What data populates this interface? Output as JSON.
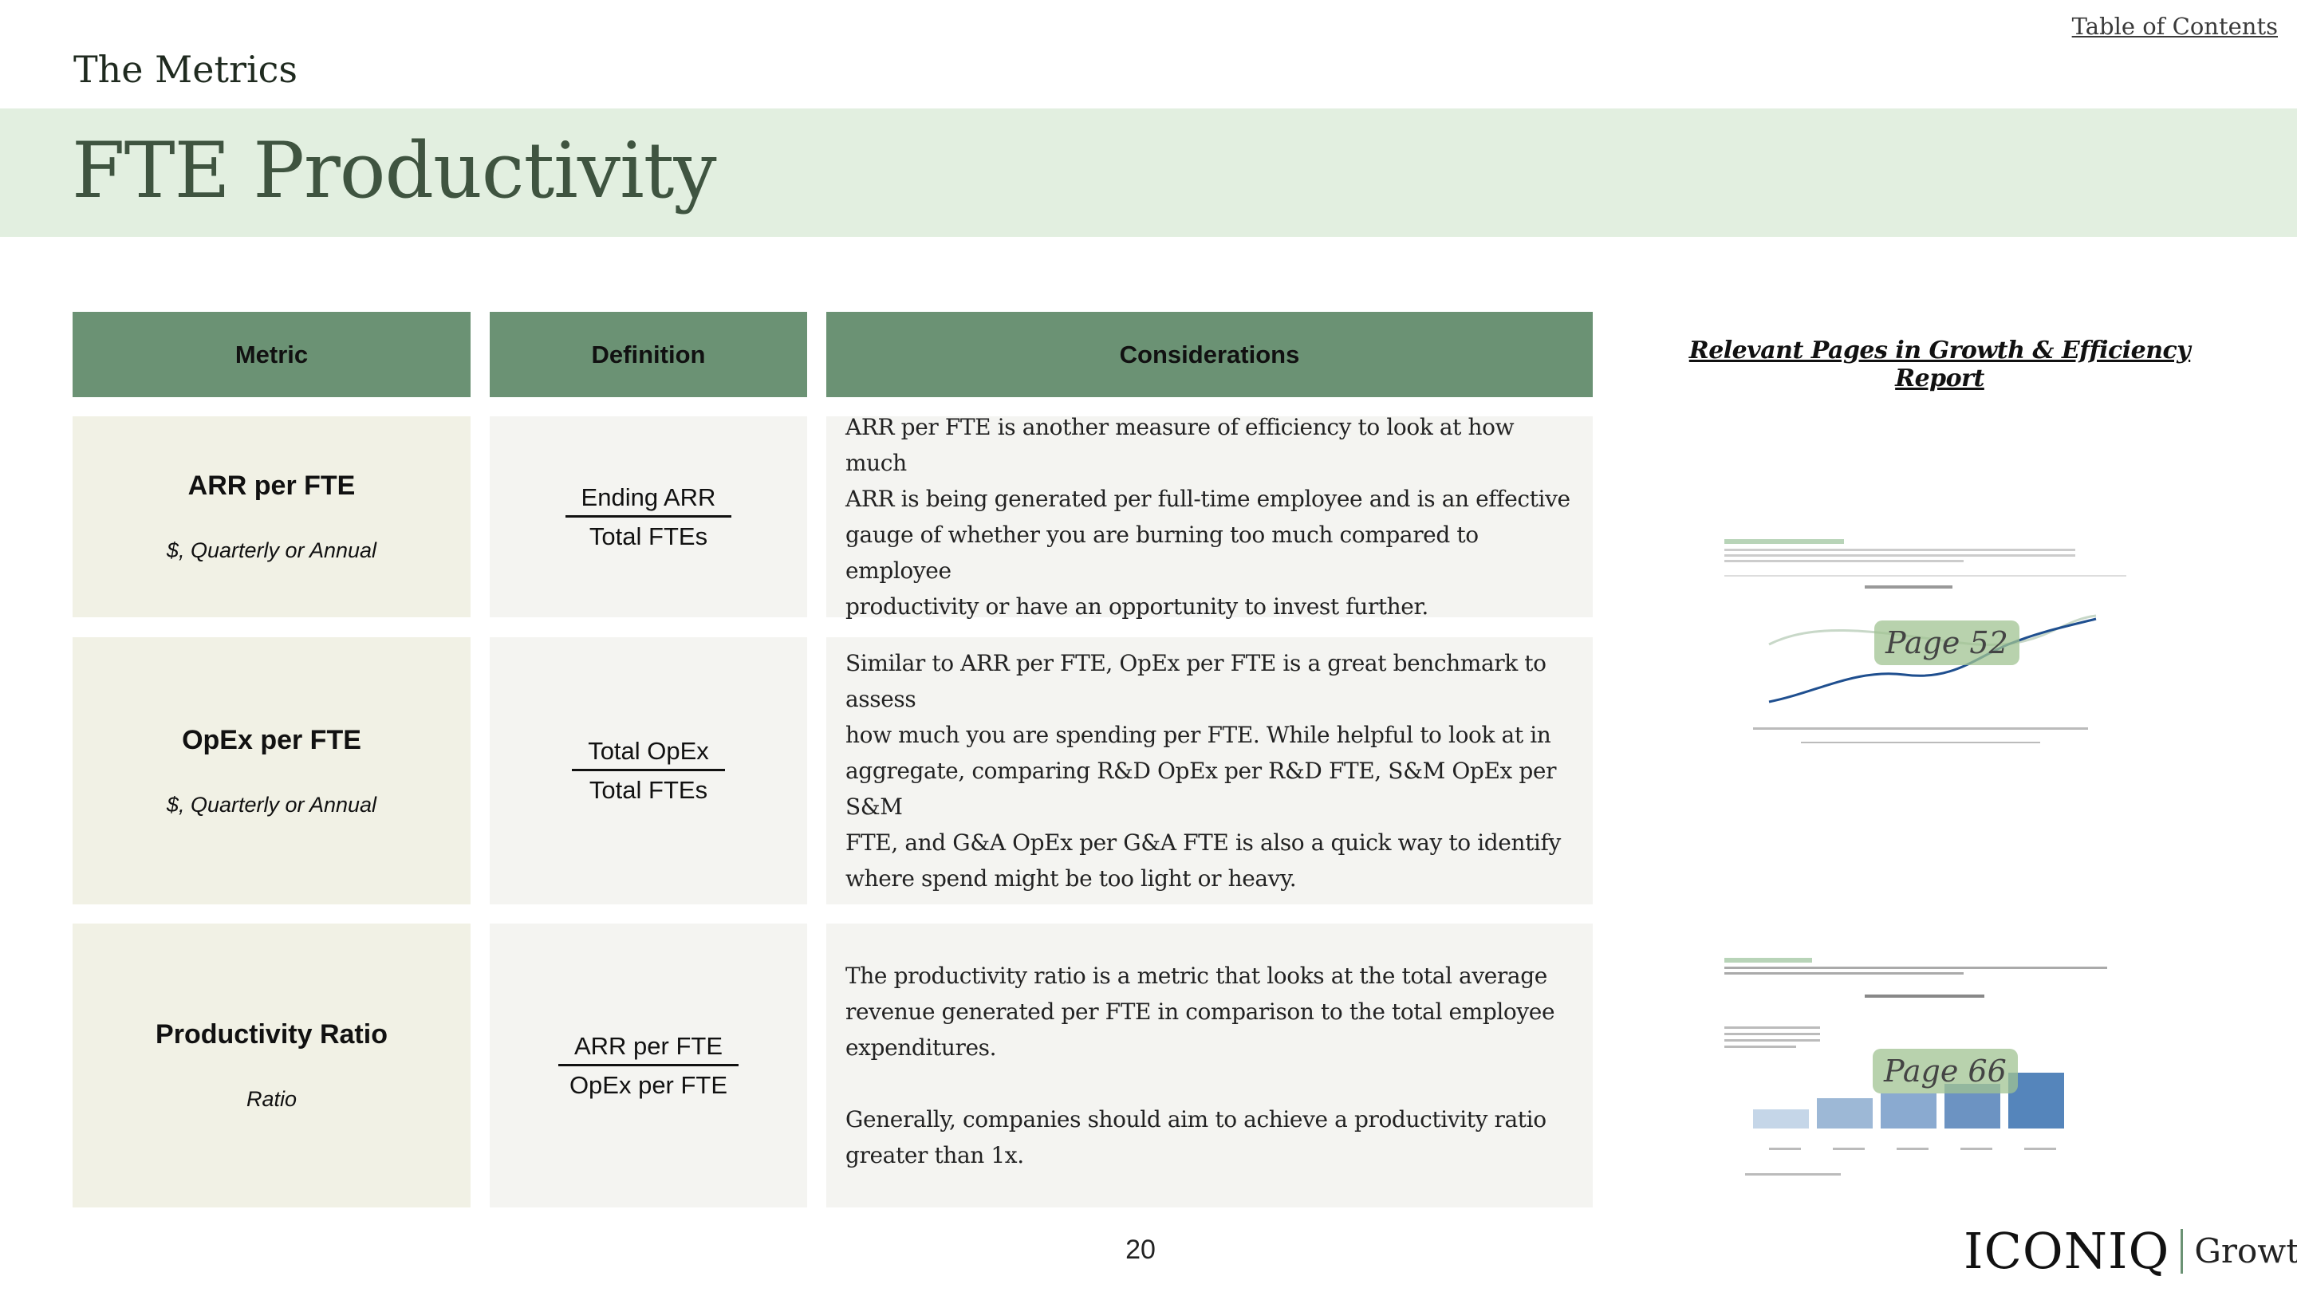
{
  "nav": {
    "toc_link": "Table of Contents"
  },
  "header": {
    "section": "The Metrics",
    "title": "FTE Productivity"
  },
  "table": {
    "headers": [
      "Metric",
      "Definition",
      "Considerations"
    ],
    "rows": [
      {
        "metric": "ARR per FTE",
        "subtitle": "$, Quarterly or Annual",
        "numerator": "Ending ARR",
        "denominator": "Total FTEs",
        "considerations": "ARR per FTE is another measure of efficiency to look at how much\nARR is being generated per full-time employee and is an effective\ngauge of whether you are burning too much compared to employee\nproductivity or have an opportunity to invest further."
      },
      {
        "metric": "OpEx per FTE",
        "subtitle": "$, Quarterly or Annual",
        "numerator": "Total OpEx",
        "denominator": "Total FTEs",
        "considerations": "Similar to ARR per FTE, OpEx per FTE is a great benchmark to assess\nhow much you are spending per FTE. While helpful to look at in\naggregate, comparing R&D OpEx per R&D FTE, S&M OpEx per S&M\nFTE, and G&A OpEx per G&A FTE is also a quick way to identify\nwhere spend might be too light or heavy."
      },
      {
        "metric": "Productivity Ratio",
        "subtitle": "Ratio",
        "numerator": "ARR per FTE",
        "denominator": "OpEx per FTE",
        "considerations": "The productivity ratio is a metric that looks at the total average\nrevenue generated per FTE in comparison to the total employee\nexpenditures.\n\nGenerally, companies should aim to achieve a productivity ratio\ngreater than 1x."
      }
    ]
  },
  "sidebar": {
    "heading": "Relevant Pages in Growth & Efficiency Report",
    "pages": [
      {
        "label": "Page 52"
      },
      {
        "label": "Page 66"
      }
    ]
  },
  "footer": {
    "page_number": "20",
    "logo_main": "ICONIQ",
    "logo_sub": "Growth"
  },
  "colors": {
    "band": "#e2efe0",
    "header_fill": "#6b9274",
    "metric_fill": "#f1f1e5",
    "cell_fill": "#f4f4f1",
    "title_text": "#3f5440"
  }
}
